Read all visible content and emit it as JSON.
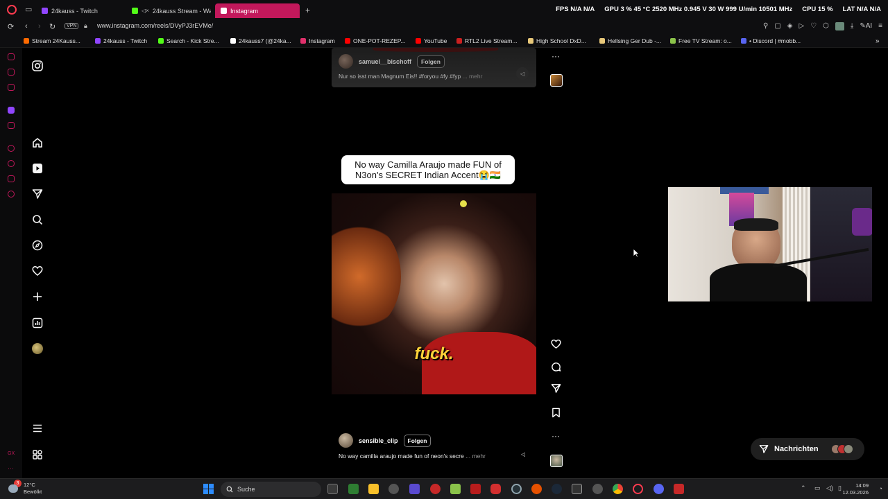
{
  "browser": {
    "tabs": [
      {
        "label": "24kauss - Twitch",
        "fav_color": "#9146ff"
      },
      {
        "label": "24kauss Stream - Wa",
        "fav_color": "#53fc18"
      },
      {
        "label": "Instagram",
        "fav_color": "#e1306c"
      }
    ],
    "stats": {
      "fps": "FPS  N/A  N/A",
      "gpu": "GPU  3 %  45 °C  2520 MHz  0.945 V  30 W  999 U/min  10501 MHz",
      "cpu": "CPU  15 %",
      "lat": "LAT  N/A  N/A"
    },
    "vpn_label": "VPN",
    "url": "www.instagram.com/reels/DVyPJ3rEVMe/"
  },
  "bookmarks": [
    {
      "label": "Stream 24Kauss...",
      "color": "#ff6a00"
    },
    {
      "label": "24kauss - Twitch",
      "color": "#9146ff"
    },
    {
      "label": "Search - Kick Stre...",
      "color": "#53fc18"
    },
    {
      "label": "24kauss7 (@24ka...",
      "color": "#ffffff"
    },
    {
      "label": "Instagram",
      "color": "#e1306c"
    },
    {
      "label": "ONE-POT-REZEP...",
      "color": "#ff0000"
    },
    {
      "label": "YouTube",
      "color": "#ff0000"
    },
    {
      "label": "RTL2 Live Stream...",
      "color": "#cc2020"
    },
    {
      "label": "High School DxD...",
      "color": "#e8c87a"
    },
    {
      "label": "Hellsing Ger Dub -...",
      "color": "#e8c87a"
    },
    {
      "label": "Free TV Stream: o...",
      "color": "#8bc34a"
    },
    {
      "label": "• Discord | #mobb...",
      "color": "#5865f2"
    }
  ],
  "reels": {
    "previous": {
      "username": "samuel__bischoff",
      "follow_label": "Folgen",
      "description": "Nur so isst man Magnum Eis!! #foryou #fy #fyp",
      "more_label": "... mehr"
    },
    "current": {
      "caption": "No way Camilla Araujo made FUN of N3on's SECRET Indian Accent😭🇮🇳",
      "subtitle": "fuck.",
      "username": "sensible_clip",
      "follow_label": "Folgen",
      "description": "No way camilla araujo made fun of neon's secre",
      "more_label": "... mehr"
    }
  },
  "messages": {
    "label": "Nachrichten"
  },
  "taskbar": {
    "notification_count": "3",
    "temperature": "12°C",
    "weather": "Bewölkt",
    "search_placeholder": "Suche",
    "time": "14:09",
    "date": "12.03.2026"
  }
}
